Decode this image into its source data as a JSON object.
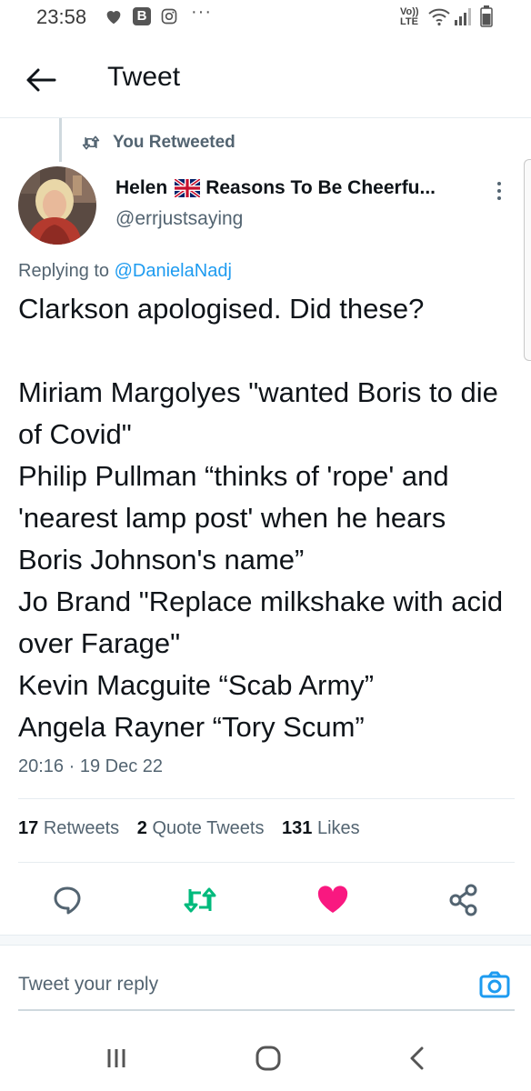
{
  "status_bar": {
    "time": "23:58",
    "network_label": "Vo)) LTE",
    "icons": [
      "heart-icon",
      "b-app-icon",
      "instagram-icon",
      "more-dots-icon",
      "wifi-icon",
      "signal-icon",
      "battery-icon"
    ],
    "more": "···"
  },
  "app_bar": {
    "back_icon": "arrow-left-icon",
    "title": "Tweet"
  },
  "retweet": {
    "icon": "retweet-icon",
    "label": "You Retweeted"
  },
  "author": {
    "name_first": "Helen",
    "flag": "uk-flag-icon",
    "name_rest": "Reasons To Be Cheerfu...",
    "handle": "@errjustsaying"
  },
  "reply_context": {
    "prefix": "Replying to",
    "mention": "@DanielaNadj"
  },
  "tweet": {
    "paragraphs": [
      "Clarkson apologised.  Did these?",
      "",
      "Miriam Margolyes \"wanted Boris to die of Covid\"",
      "Philip Pullman “thinks of 'rope' and 'nearest lamp post' when he hears Boris Johnson's name”",
      "Jo Brand \"Replace milkshake with acid over Farage\"",
      "Kevin Macguite “Scab Army”",
      "Angela Rayner “Tory Scum”"
    ],
    "timestamp": "20:16 · 19 Dec 22"
  },
  "stats": {
    "retweets_count": "17",
    "retweets_label": "Retweets",
    "quotes_count": "2",
    "quotes_label": "Quote Tweets",
    "likes_count": "131",
    "likes_label": "Likes"
  },
  "actions": {
    "reply_icon": "reply-icon",
    "retweet_icon": "retweet-icon",
    "like_icon": "heart-icon",
    "share_icon": "share-icon",
    "retweet_color": "#00ba7c",
    "like_color": "#f91880"
  },
  "reply_box": {
    "placeholder": "Tweet your reply",
    "camera_icon": "camera-icon",
    "accent": "#1d9bf0"
  },
  "nav_bar": {
    "icons": [
      "recent-apps-icon",
      "home-icon",
      "back-icon"
    ]
  }
}
